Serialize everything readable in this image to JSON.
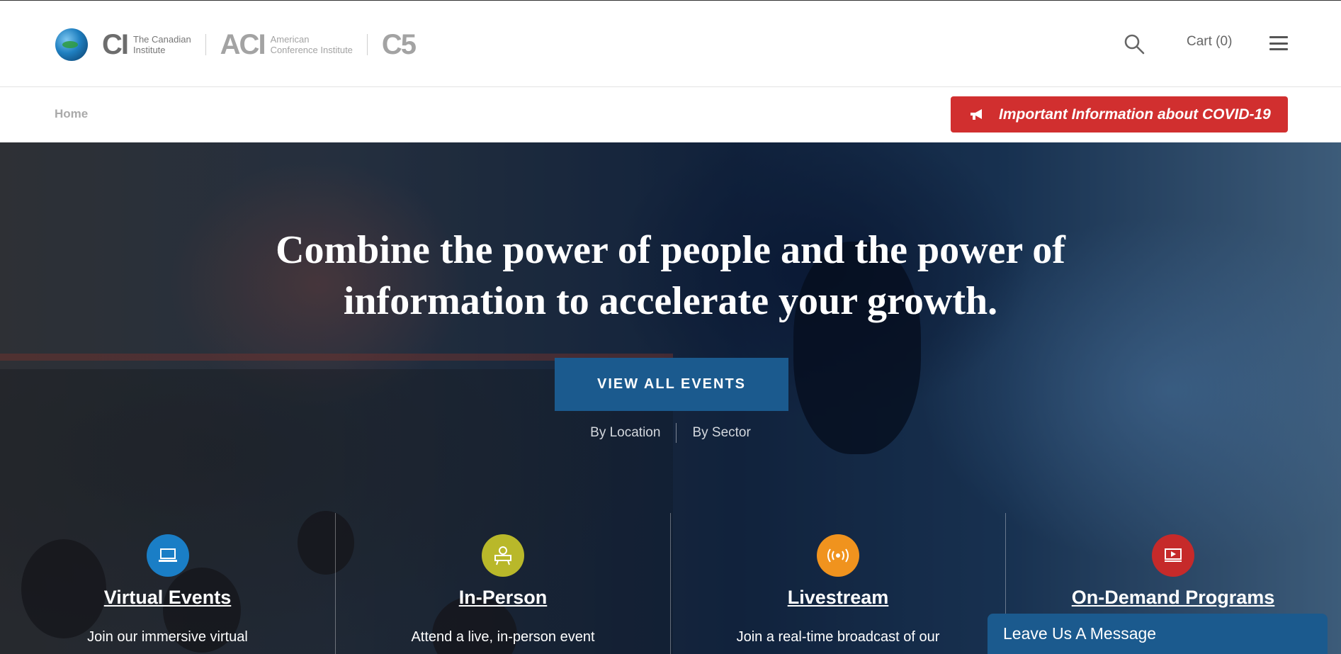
{
  "header": {
    "logos": {
      "ci_mark": "CI",
      "ci_sub_line1": "The Canadian",
      "ci_sub_line2": "Institute",
      "aci_mark": "ACI",
      "aci_sub_line1": "American",
      "aci_sub_line2": "Conference Institute",
      "c5_mark": "C5"
    },
    "cart_label": "Cart (0)",
    "icons": {
      "search": "search-icon",
      "menu": "hamburger-menu-icon",
      "globe": "globe-logo-icon"
    }
  },
  "subbar": {
    "breadcrumb": "Home",
    "covid_label": "Important Information about COVID-19",
    "covid_color": "#d12f2f"
  },
  "hero": {
    "headline": "Combine the power of people and the power of information to accelerate your growth.",
    "cta_label": "VIEW ALL EVENTS",
    "links": [
      "By Location",
      "By Sector"
    ],
    "categories": [
      {
        "title": "Virtual Events",
        "desc": "Join our immersive virtual",
        "icon": "laptop-icon",
        "color": "#1a7ec6"
      },
      {
        "title": "In-Person",
        "desc": "Attend a live, in-person event",
        "icon": "presenter-icon",
        "color": "#b9b82a"
      },
      {
        "title": "Livestream",
        "desc": "Join a real-time broadcast of our",
        "icon": "broadcast-icon",
        "color": "#f0931e"
      },
      {
        "title": "On-Demand Programs",
        "desc": "",
        "icon": "video-play-icon",
        "color": "#c62a2a"
      }
    ]
  },
  "chat": {
    "label": "Leave Us A Message"
  },
  "colors": {
    "primary_blue": "#1b5a8e",
    "alert_red": "#d12f2f"
  }
}
